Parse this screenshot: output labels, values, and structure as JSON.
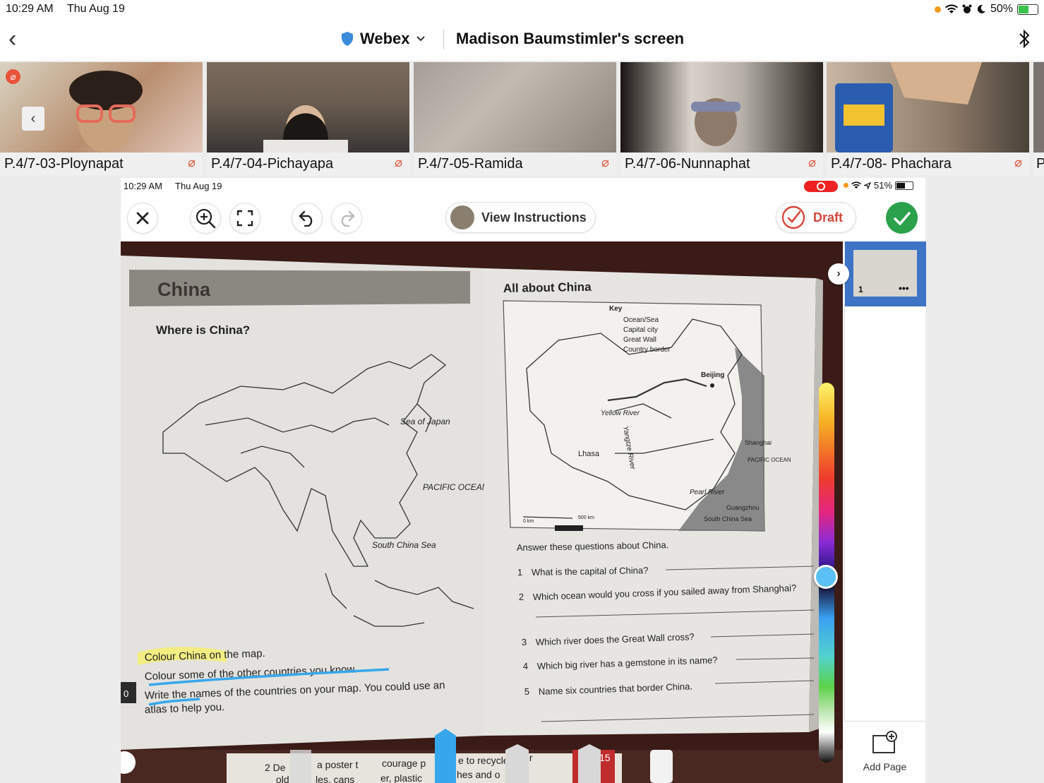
{
  "ios_status": {
    "time": "10:29 AM",
    "date": "Thu Aug 19",
    "battery": "50%"
  },
  "webex_bar": {
    "app_name": "Webex",
    "share_title": "Madison Baumstimler's screen"
  },
  "participants": [
    {
      "name": "P.4/7-03-Ploynapat"
    },
    {
      "name": "P.4/7-04-Pichayapa"
    },
    {
      "name": "P.4/7-05-Ramida"
    },
    {
      "name": "P.4/7-06-Nunnaphat"
    },
    {
      "name": "P.4/7-08- Phachara"
    },
    {
      "name": "P"
    }
  ],
  "shared": {
    "status": {
      "time": "10:29 AM",
      "date": "Thu Aug 19",
      "battery": "51%"
    },
    "toolbar": {
      "view_instructions": "View Instructions",
      "draft": "Draft"
    },
    "sidebar": {
      "page_number": "1",
      "more": "•••",
      "add_page": "Add Page"
    },
    "colors": {
      "done_green": "#2aa14a",
      "draft_red": "#d6463a",
      "thumb_blue": "#3d74c6",
      "highlight_yellow": "#f6f06a",
      "pen_blue": "#36a7ec"
    },
    "book": {
      "left_title": "China",
      "left_heading": "Where is China?",
      "left_map_labels": [
        "Sea of Japan",
        "PACIFIC OCEAN",
        "South China Sea"
      ],
      "left_instructions": [
        "Colour China on the map.",
        "Colour some of the other countries you know.",
        "Write the names of the countries on your map. You could use an",
        "atlas to help you."
      ],
      "left_margin": "0",
      "right_title": "All about China",
      "key_title": "Key",
      "key_items": [
        "Ocean/Sea",
        "Capital city",
        "Great Wall",
        "Country border"
      ],
      "right_map_labels": [
        "Beijing",
        "Yellow River",
        "Lhasa",
        "Yangtze River",
        "Shanghai",
        "PACIFIC OCEAN",
        "Pearl River",
        "Guangzhou",
        "South China Sea",
        "0 km",
        "500 km"
      ],
      "questions_heading": "Answer these questions about China.",
      "questions": [
        {
          "n": "1",
          "q": "What is the capital of China?"
        },
        {
          "n": "2",
          "q": "Which ocean would you cross if you sailed away from Shanghai?"
        },
        {
          "n": "3",
          "q": "Which river does the Great Wall cross?"
        },
        {
          "n": "4",
          "q": "Which big river has a gemstone in its name?"
        },
        {
          "n": "5",
          "q": "Name six countries that border China."
        }
      ],
      "bottom_text": [
        "2 De",
        "a poster t",
        "courage p",
        "e to recycle",
        "eir",
        "old",
        "les, cans",
        "er, plastic",
        "hes and o",
        "15"
      ]
    }
  }
}
